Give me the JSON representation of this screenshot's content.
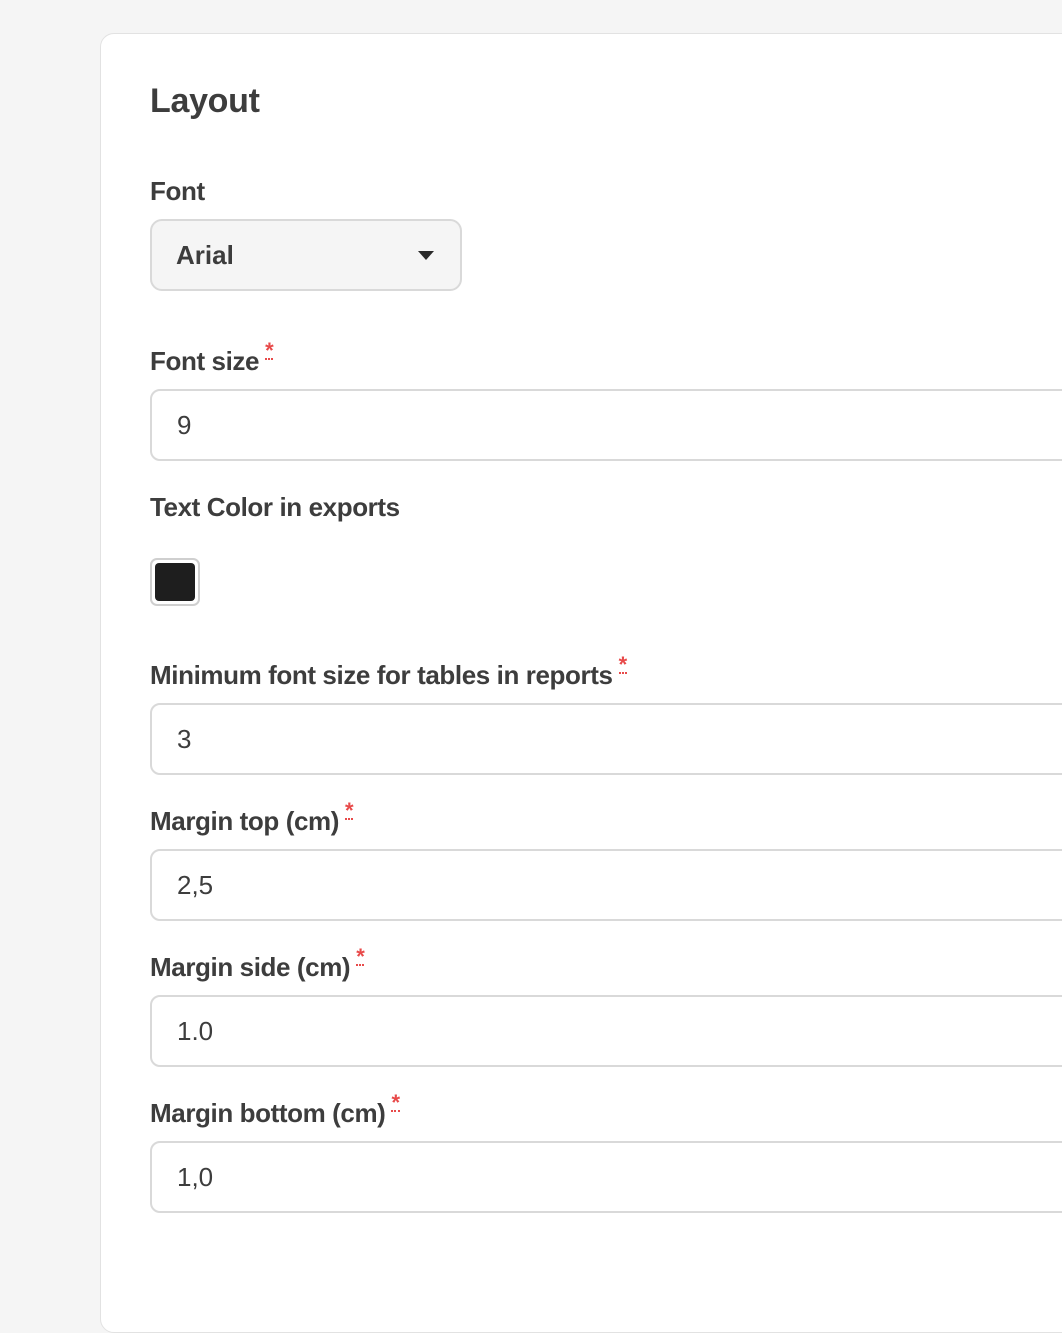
{
  "section": {
    "title": "Layout"
  },
  "font": {
    "label": "Font",
    "selected": "Arial",
    "icon": "chevron-down-icon"
  },
  "font_size": {
    "label": "Font size",
    "required_mark": "*",
    "value": "9"
  },
  "text_color": {
    "label": "Text Color in exports",
    "color": "#1e1e1e"
  },
  "min_table_font_size": {
    "label": "Minimum font size for tables in reports",
    "required_mark": "*",
    "value": "3"
  },
  "margin_top": {
    "label": "Margin top (cm)",
    "required_mark": "*",
    "value": "2,5"
  },
  "margin_side": {
    "label": "Margin side (cm)",
    "required_mark": "*",
    "value": "1.0"
  },
  "margin_bottom": {
    "label": "Margin bottom (cm)",
    "required_mark": "*",
    "value": "1,0"
  },
  "colors": {
    "page_background": "#f5f5f5",
    "panel_background": "#ffffff",
    "text": "#3d3d3d",
    "required": "#e84a4a",
    "border": "#d9d9d9"
  }
}
